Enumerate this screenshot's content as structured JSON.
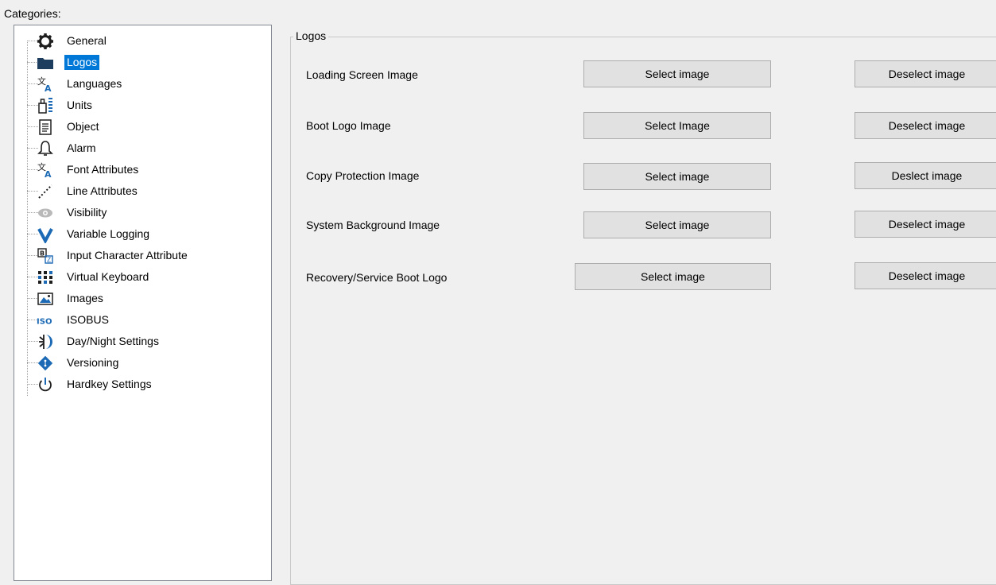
{
  "categories_label": "Categories:",
  "tree": {
    "items": [
      {
        "label": "General",
        "icon": "gear-icon"
      },
      {
        "label": "Logos",
        "icon": "folder-icon",
        "selected": true
      },
      {
        "label": "Languages",
        "icon": "language-icon"
      },
      {
        "label": "Units",
        "icon": "units-icon"
      },
      {
        "label": "Object",
        "icon": "document-icon"
      },
      {
        "label": "Alarm",
        "icon": "bell-icon"
      },
      {
        "label": "Font Attributes",
        "icon": "font-icon"
      },
      {
        "label": "Line Attributes",
        "icon": "line-icon"
      },
      {
        "label": "Visibility",
        "icon": "eye-icon"
      },
      {
        "label": "Variable Logging",
        "icon": "v-icon"
      },
      {
        "label": "Input Character Attribute",
        "icon": "input-char-icon"
      },
      {
        "label": "Virtual Keyboard",
        "icon": "keyboard-icon"
      },
      {
        "label": "Images",
        "icon": "image-icon"
      },
      {
        "label": "ISOBUS",
        "icon": "iso-icon"
      },
      {
        "label": "Day/Night Settings",
        "icon": "day-night-icon"
      },
      {
        "label": "Versioning",
        "icon": "git-icon"
      },
      {
        "label": "Hardkey Settings",
        "icon": "power-icon"
      }
    ]
  },
  "logos": {
    "title": "Logos",
    "rows": [
      {
        "label": "Loading Screen Image",
        "select": "Select image",
        "deselect": "Deselect image"
      },
      {
        "label": "Boot Logo Image",
        "select": "Select Image",
        "deselect": "Deselect image"
      },
      {
        "label": "Copy Protection Image",
        "select": "Select image",
        "deselect": "Deslect image"
      },
      {
        "label": "System Background Image",
        "select": "Select image",
        "deselect": "Deselect image"
      },
      {
        "label": "Recovery/Service Boot Logo",
        "select": "Select image",
        "deselect": "Deselect image"
      }
    ]
  },
  "colors": {
    "selection": "#0078d7",
    "icon_blue": "#1c6ab5",
    "icon_dark": "#1e1e1e"
  }
}
